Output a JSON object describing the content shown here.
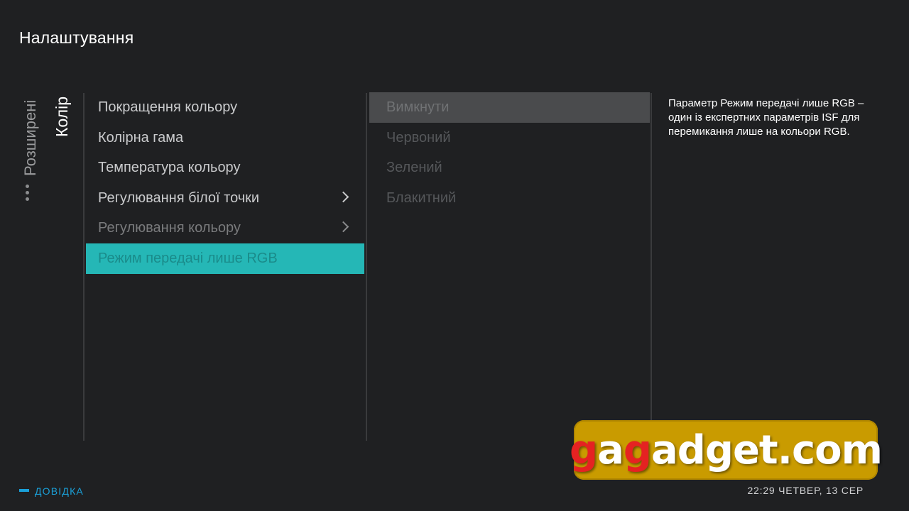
{
  "header": {
    "title": "Налаштування"
  },
  "breadcrumbs": {
    "previous": "Розширені",
    "current": "Колір"
  },
  "menu": {
    "items": [
      {
        "label": "Покращення кольору",
        "state": "normal",
        "has_submenu": false
      },
      {
        "label": "Колірна гама",
        "state": "normal",
        "has_submenu": false
      },
      {
        "label": "Температура кольору",
        "state": "normal",
        "has_submenu": false
      },
      {
        "label": "Регулювання білої точки",
        "state": "normal",
        "has_submenu": true
      },
      {
        "label": "Регулювання кольору",
        "state": "dim",
        "has_submenu": true
      },
      {
        "label": "Режим передачі лише RGB",
        "state": "selected",
        "has_submenu": false
      }
    ]
  },
  "options": {
    "items": [
      {
        "label": "Вимкнути",
        "focused": true
      },
      {
        "label": "Червоний",
        "focused": false
      },
      {
        "label": "Зелений",
        "focused": false
      },
      {
        "label": "Блакитний",
        "focused": false
      }
    ]
  },
  "info": {
    "text": "Параметр Режим передачі лише RGB – один із експертних параметрів ISF для перемикання лише на кольори RGB."
  },
  "footer": {
    "help_label": "ДОВІДКА",
    "clock": "22:29 ЧЕТВЕР, 13 СЕР"
  },
  "watermark": {
    "text": "gagadget.com"
  },
  "colors": {
    "background": "#1f2022",
    "selected": "#25b7b6",
    "focus": "#4a4b4d",
    "help_accent": "#1aa0d8",
    "watermark_bg": "#c99b00"
  }
}
